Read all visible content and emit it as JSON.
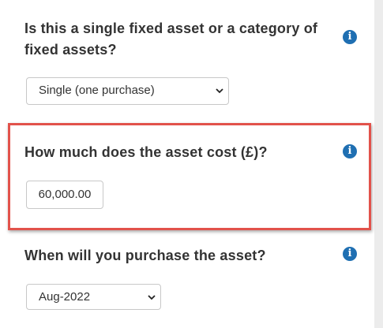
{
  "questions": [
    {
      "label_line1": "Is this a single fixed asset or a category of",
      "label_line2": "fixed assets?",
      "select_value": "Single (one purchase)",
      "info_icon": "info-icon"
    },
    {
      "label": "How much does the asset cost (£)?",
      "input_value": "60,000.00",
      "info_icon": "info-icon"
    },
    {
      "label": "When will you purchase the asset?",
      "select_value": "Aug-2022",
      "info_icon": "info-icon"
    }
  ],
  "info_glyph": "i",
  "colors": {
    "highlight_border": "#e2524b",
    "info_icon": "#1f6fb2",
    "question_text": "#333333"
  }
}
